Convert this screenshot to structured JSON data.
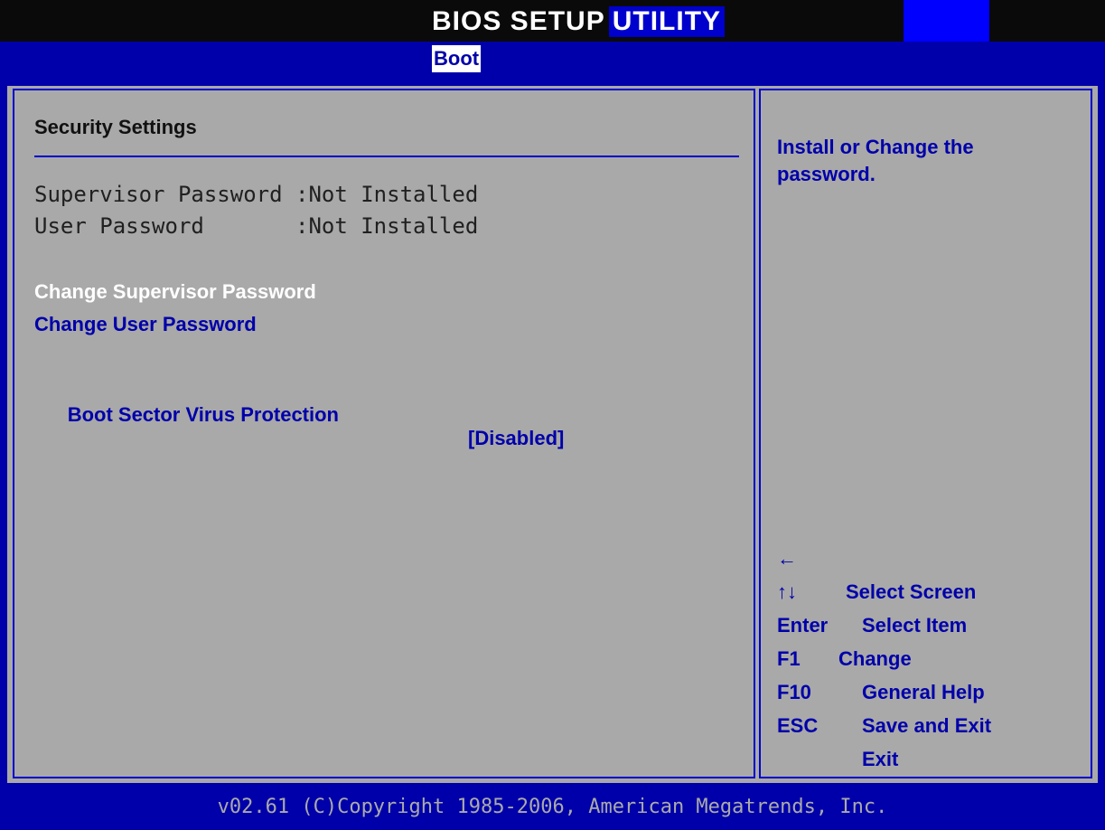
{
  "header": {
    "title_part_1": "BIOS SETUP",
    "title_part_2": "UTILITY",
    "active_tab": "Boot"
  },
  "main": {
    "section_title": "Security Settings",
    "supervisor_label": "Supervisor Password :",
    "supervisor_value": "Not Installed",
    "user_label": "User Password       :",
    "user_value": "Not Installed",
    "change_supervisor_label": "Change Supervisor Password",
    "change_user_label": "Change User Password",
    "boot_sector_label": "Boot Sector Virus Protection",
    "boot_sector_value": "[Disabled]"
  },
  "help": {
    "text": "Install or Change the password."
  },
  "keys": [
    {
      "key": "←",
      "desc": "Select Screen"
    },
    {
      "key": "↑↓",
      "desc": "Select Item"
    },
    {
      "key": "Enter",
      "desc": "Change"
    },
    {
      "key": "F1",
      "desc": "General Help"
    },
    {
      "key": "F10",
      "desc": "Save and Exit"
    },
    {
      "key": "ESC",
      "desc": "Exit"
    }
  ],
  "footer": {
    "text": "v02.61 (C)Copyright 1985-2006, American Megatrends, Inc."
  },
  "colors": {
    "background_blue": "#0000aa",
    "panel_gray": "#a9a9a9",
    "highlight_white": "#ffffff",
    "accent_blue": "#0000cc"
  }
}
